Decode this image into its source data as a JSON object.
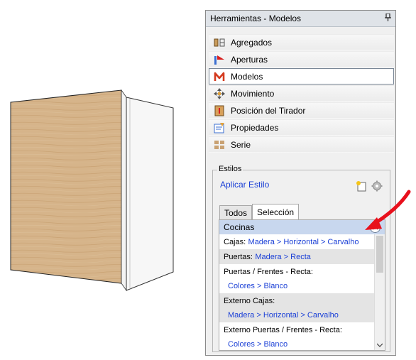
{
  "panel": {
    "title": "Herramientas - Modelos",
    "pin_glyph": "📌"
  },
  "menu": [
    {
      "label": "Agregados",
      "icon": "agregados-icon"
    },
    {
      "label": "Aperturas",
      "icon": "aperturas-icon"
    },
    {
      "label": "Modelos",
      "icon": "modelos-icon",
      "selected": true
    },
    {
      "label": "Movimiento",
      "icon": "movimiento-icon"
    },
    {
      "label": "Posición del Tirador",
      "icon": "tirador-icon"
    },
    {
      "label": "Propiedades",
      "icon": "propiedades-icon"
    },
    {
      "label": "Serie",
      "icon": "serie-icon"
    }
  ],
  "estilos": {
    "legend": "Estilos",
    "apply_link": "Aplicar Estilo",
    "tabs": [
      "Todos",
      "Selección"
    ],
    "active_tab": "Selección",
    "group_header": "Cocinas",
    "collapse_glyph": "«",
    "rows": {
      "cajas_label": "Cajas:",
      "cajas_value": "Madera > Horizontal > Carvalho",
      "puertas_label": "Puertas:",
      "puertas_value": "Madera > Recta",
      "puertas_frentes_label": "Puertas / Frentes - Recta:",
      "puertas_frentes_value": "Colores > Blanco",
      "externo_cajas_label": "Externo Cajas:",
      "externo_cajas_value": "Madera > Horizontal > Carvalho",
      "externo_puertas_label": "Externo Puertas / Frentes - Recta:",
      "externo_puertas_value": "Colores > Blanco"
    }
  },
  "colors": {
    "link": "#1a3fd6",
    "header_bg": "#c8d7ee",
    "annotation_arrow": "#e8101c",
    "wood": "#d6b48a"
  }
}
